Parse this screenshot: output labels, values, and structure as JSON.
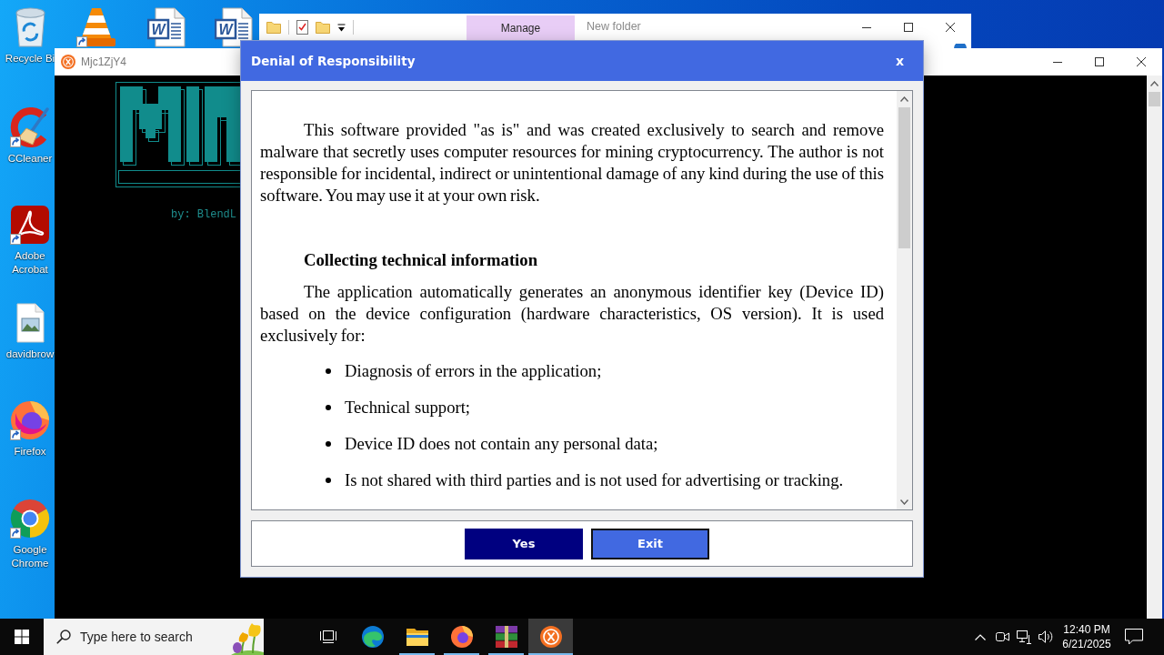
{
  "desktop": {
    "top_row": [
      {
        "kind": "recycle-bin",
        "label": "Recycle Bi",
        "shortcut": false
      },
      {
        "kind": "vlc",
        "shortcut": true
      },
      {
        "kind": "word-doc",
        "letter": "W",
        "shortcut": false
      },
      {
        "kind": "word-doc",
        "letter": "W",
        "shortcut": false
      }
    ],
    "left_column": [
      {
        "kind": "ccleaner",
        "label": "CCleaner",
        "shortcut": true
      },
      {
        "kind": "pdf",
        "label": "Adobe Acrobat",
        "shortcut": true
      },
      {
        "kind": "image-file",
        "label": "davidbrow",
        "shortcut": false
      },
      {
        "kind": "firefox",
        "label": "Firefox",
        "shortcut": true
      },
      {
        "kind": "chrome",
        "label": "Google Chrome",
        "shortcut": true
      }
    ]
  },
  "explorer_window": {
    "quick_access": [
      {
        "kind": "folder"
      },
      {
        "kind": "properties"
      },
      {
        "kind": "folder"
      },
      {
        "kind": "customize"
      }
    ],
    "ribbon_tab": {
      "label": "Manage"
    },
    "title": "New folder"
  },
  "console_window": {
    "title": "Mjc1ZjY4",
    "byline": "by: BlendL"
  },
  "dialog": {
    "title": "Denial of Responsibility",
    "close": "x",
    "content": [
      {
        "kind": "paragraph",
        "text": "This software provided \"as is\" and was created exclusively to search and remove malware that secretly uses computer resources for mining cryptocurrency. The author is not responsible for incidental, indirect or unintentional damage of any kind during the use of this software. You may use it at your own risk."
      },
      {
        "kind": "heading",
        "text": "Collecting technical information"
      },
      {
        "kind": "paragraph",
        "text": "The application automatically generates an anonymous identifier key (Device ID) based on the device configuration (hardware characteristics, OS version). It is used exclusively for:"
      },
      {
        "kind": "bullet",
        "text": "Diagnosis of errors in the application;"
      },
      {
        "kind": "bullet",
        "text": "Technical support;"
      },
      {
        "kind": "bullet",
        "text": "Device ID does not contain any personal data;"
      },
      {
        "kind": "bullet",
        "text": "Is not shared with third parties and is not used for advertising or tracking."
      }
    ],
    "buttons": [
      {
        "label": "Yes",
        "kind": "primary",
        "focused": false
      },
      {
        "label": "Exit",
        "kind": "secondary",
        "focused": true
      }
    ]
  },
  "taskbar": {
    "search": {
      "placeholder": "Type here to search"
    },
    "apps": [
      {
        "kind": "task-view",
        "running": false,
        "selected": false
      },
      {
        "kind": "swirl",
        "running": false,
        "selected": false
      },
      {
        "kind": "folder",
        "running": true,
        "selected": false
      },
      {
        "kind": "firefox",
        "running": true,
        "selected": false
      },
      {
        "kind": "books",
        "running": true,
        "selected": false
      },
      {
        "kind": "app",
        "running": true,
        "selected": true
      }
    ],
    "tray": [
      {
        "kind": "chevron"
      },
      {
        "kind": "video-camera"
      },
      {
        "kind": "network"
      },
      {
        "kind": "volume"
      }
    ],
    "clock": {
      "time": "12:40 PM",
      "date": "6/21/2025"
    }
  }
}
